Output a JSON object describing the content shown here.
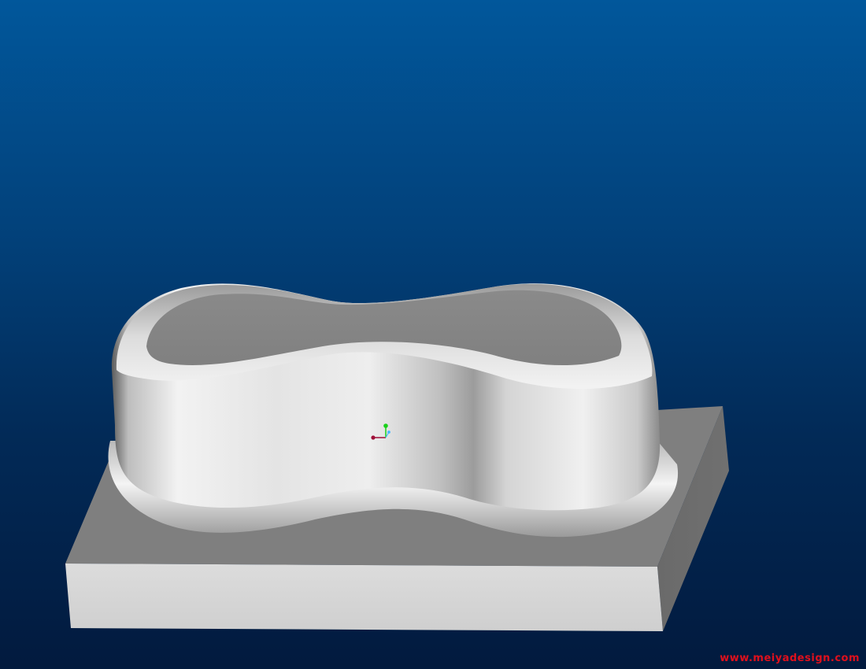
{
  "viewport": {
    "background_top": "#01579b",
    "background_bottom": "#021a3e"
  },
  "model": {
    "base_top_color": "#7f7f7f",
    "base_front_color": "#d3d3d3",
    "base_side_color": "#6d6d6d",
    "body_color": "#e6e6e6"
  },
  "triad": {
    "icon": "coordinate-triad-icon",
    "x_color": "#a0103a",
    "y_color": "#19d119",
    "z_color": "#46b8ff"
  },
  "watermark": {
    "text": "www.meiyadesign.com",
    "color": "#e0101c"
  }
}
